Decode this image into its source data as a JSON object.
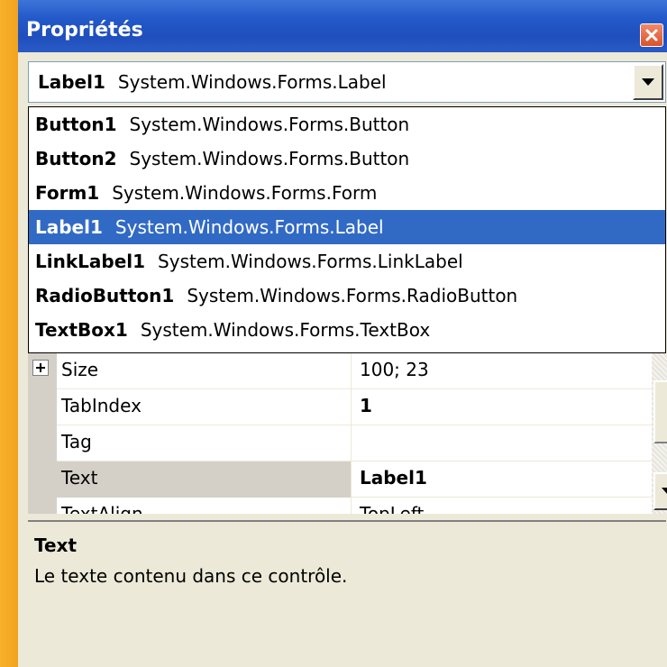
{
  "window": {
    "title": "Propriétés",
    "close_icon": "close-icon"
  },
  "object_selector": {
    "selected_name": "Label1",
    "selected_type": "System.Windows.Forms.Label",
    "arrow_icon": "chevron-down-icon"
  },
  "dropdown": {
    "items": [
      {
        "name": "Button1",
        "type": "System.Windows.Forms.Button"
      },
      {
        "name": "Button2",
        "type": "System.Windows.Forms.Button"
      },
      {
        "name": "Form1",
        "type": "System.Windows.Forms.Form"
      },
      {
        "name": "Label1",
        "type": "System.Windows.Forms.Label"
      },
      {
        "name": "LinkLabel1",
        "type": "System.Windows.Forms.LinkLabel"
      },
      {
        "name": "RadioButton1",
        "type": "System.Windows.Forms.RadioButton"
      },
      {
        "name": "TextBox1",
        "type": "System.Windows.Forms.TextBox"
      }
    ],
    "selected_index": 3
  },
  "grid": {
    "rows": [
      {
        "name": "Size",
        "value": "100; 23"
      },
      {
        "name": "TabIndex",
        "value": "1"
      },
      {
        "name": "Tag",
        "value": ""
      },
      {
        "name": "Text",
        "value": "Label1"
      },
      {
        "name": "TextAlign",
        "value": "TopLeft"
      }
    ]
  },
  "description": {
    "title": "Text",
    "text": "Le texte contenu dans ce contrôle."
  },
  "colors": {
    "titlebar": "#2359c9",
    "selection": "#316ac5",
    "face": "#ece9d8",
    "background": "#f5a623"
  }
}
